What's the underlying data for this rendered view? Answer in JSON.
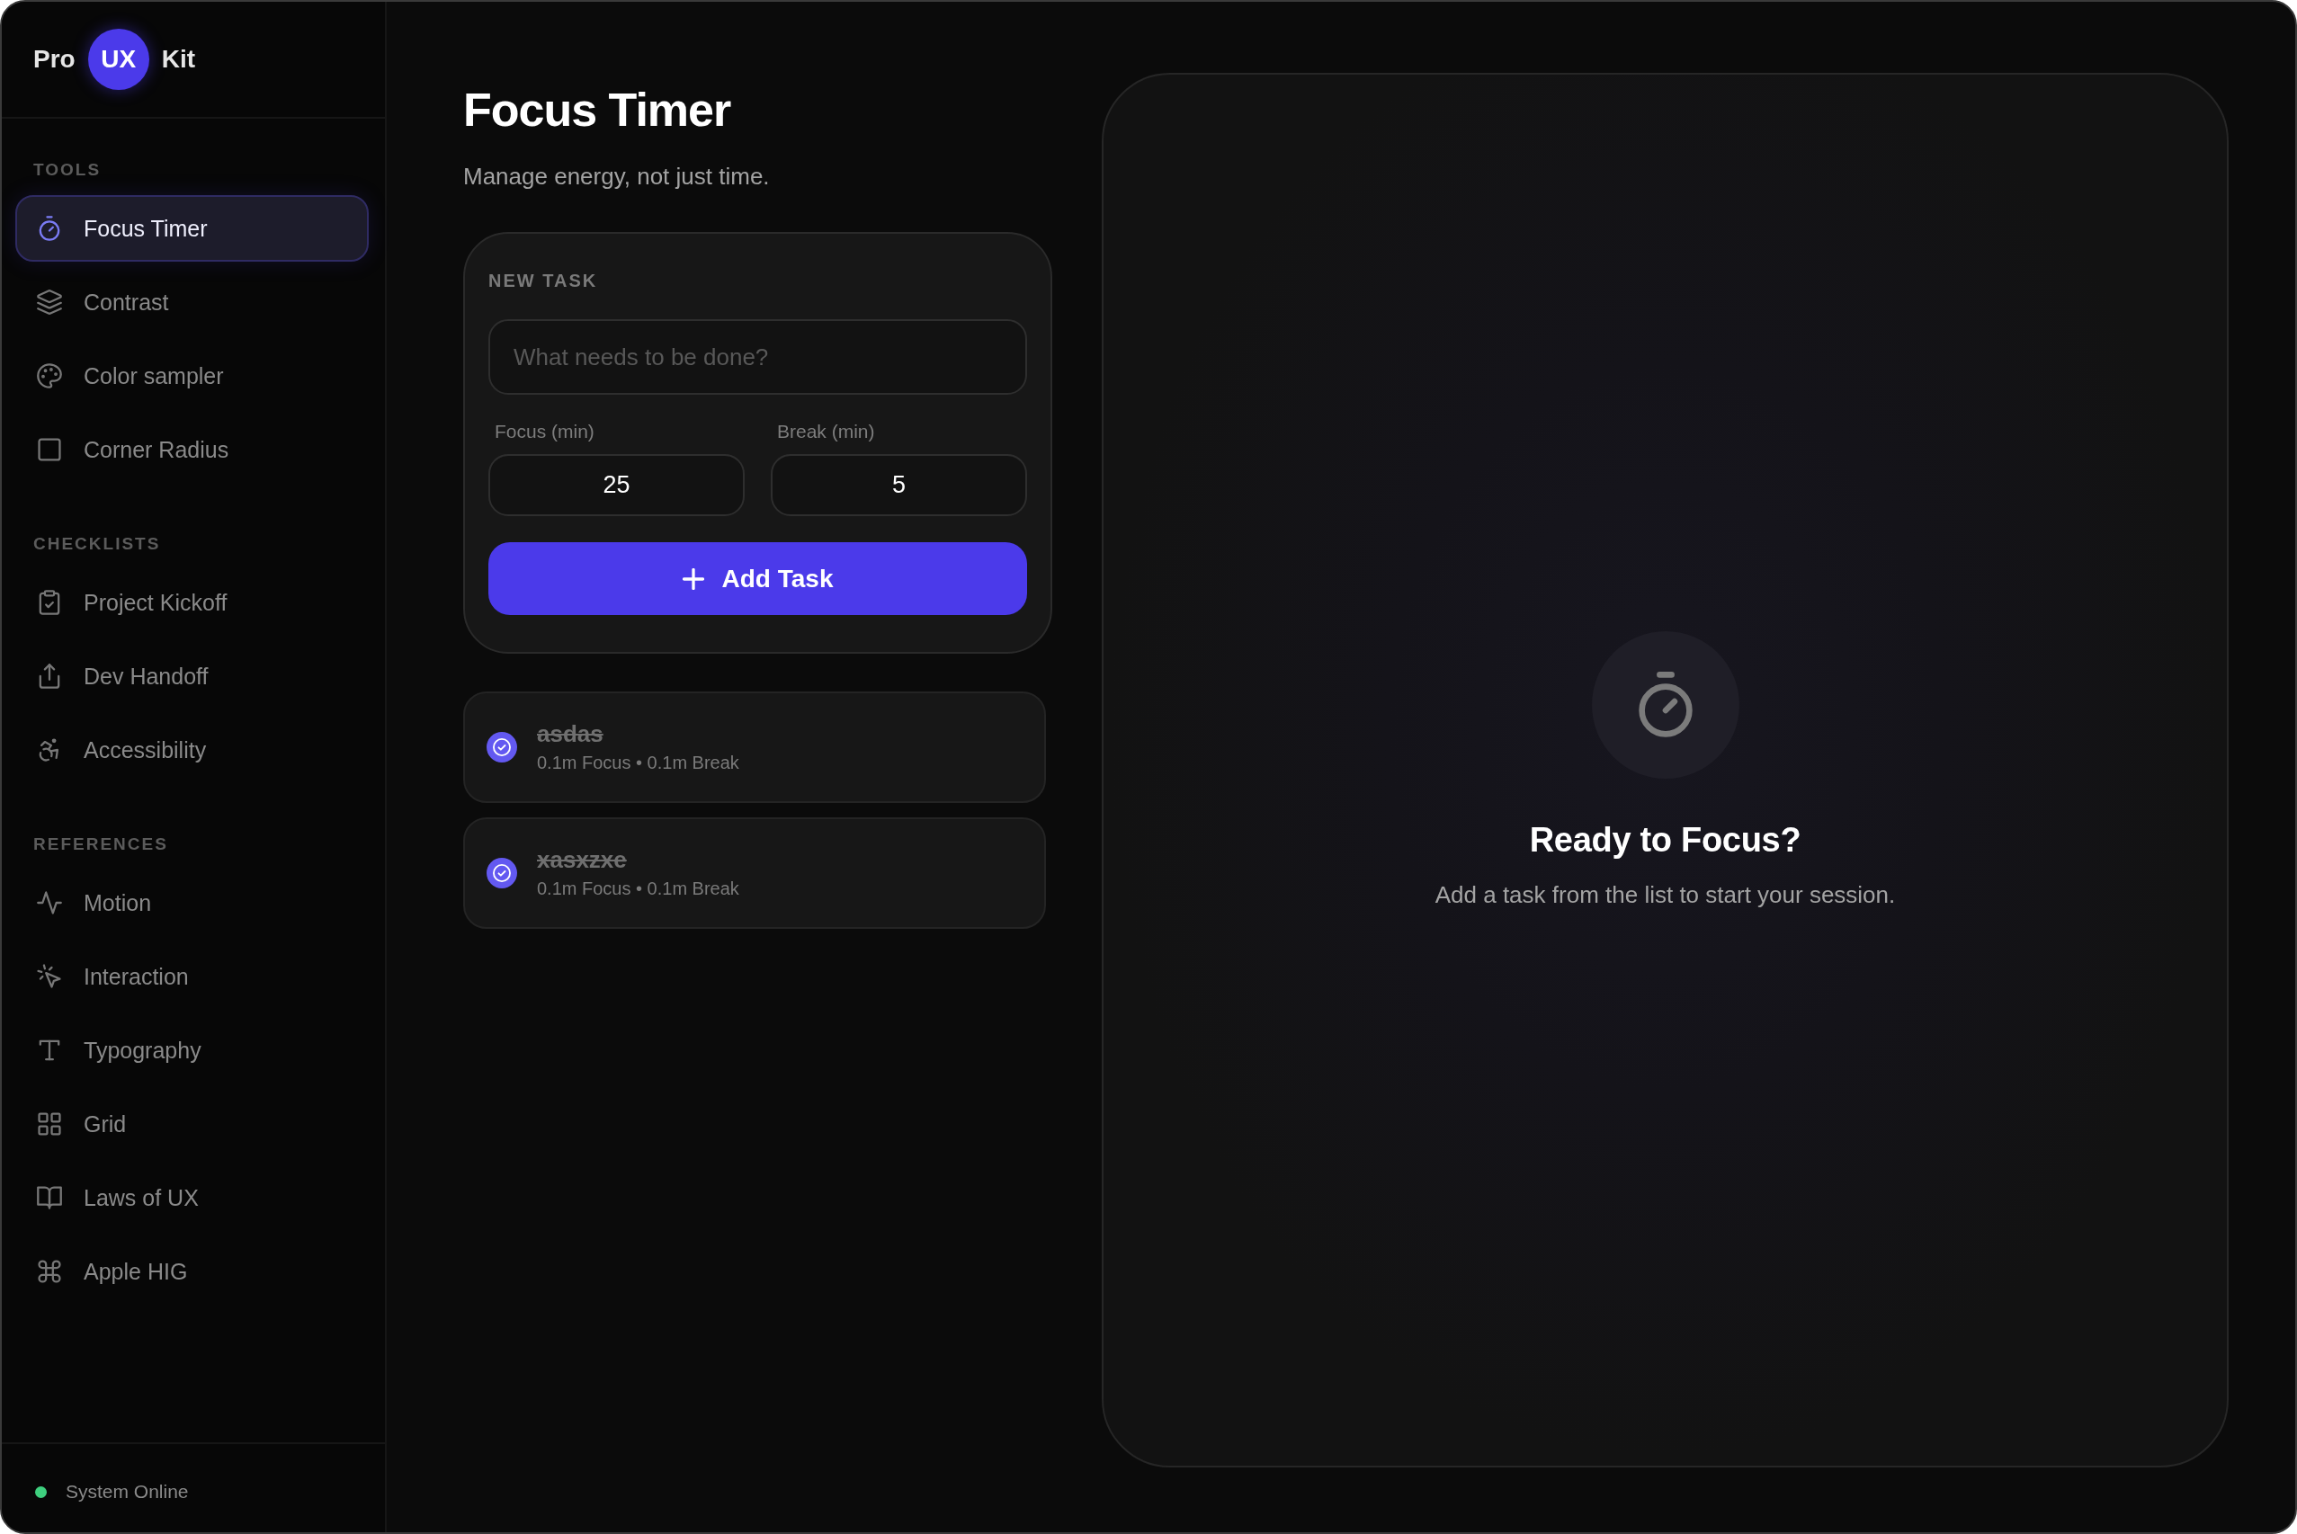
{
  "sidebar": {
    "logo": {
      "prefix": "Pro",
      "badge": "UX",
      "suffix": "Kit"
    },
    "sections": [
      {
        "heading": "TOOLS",
        "items": [
          {
            "label": "Focus Timer",
            "selected": true
          },
          {
            "label": "Contrast",
            "selected": false
          },
          {
            "label": "Color sampler",
            "selected": false
          },
          {
            "label": "Corner Radius",
            "selected": false
          }
        ]
      },
      {
        "heading": "CHECKLISTS",
        "items": [
          {
            "label": "Project Kickoff",
            "selected": false
          },
          {
            "label": "Dev Handoff",
            "selected": false
          },
          {
            "label": "Accessibility",
            "selected": false
          }
        ]
      },
      {
        "heading": "REFERENCES",
        "items": [
          {
            "label": "Motion",
            "selected": false
          },
          {
            "label": "Interaction",
            "selected": false
          },
          {
            "label": "Typography",
            "selected": false
          },
          {
            "label": "Grid",
            "selected": false
          },
          {
            "label": "Laws of UX",
            "selected": false
          },
          {
            "label": "Apple HIG",
            "selected": false
          }
        ]
      }
    ],
    "status": {
      "label": "System Online",
      "online": true
    }
  },
  "page": {
    "title": "Focus Timer",
    "subtitle": "Manage energy, not just time."
  },
  "new_task": {
    "heading": "NEW TASK",
    "task_field": {
      "placeholder": "What needs to be done?"
    },
    "focus_field": {
      "label": "Focus (min)",
      "value": "25"
    },
    "break_field": {
      "label": "Break (min)",
      "value": "5"
    },
    "add_button": "Add Task"
  },
  "tasks": [
    {
      "title": "asdas",
      "details": "0.1m Focus • 0.1m Break",
      "done": true
    },
    {
      "title": "xasxzxe",
      "details": "0.1m Focus • 0.1m Break",
      "done": true
    }
  ],
  "session_panel": {
    "title": "Ready to Focus?",
    "message": "Add a task from the list to start your session."
  }
}
